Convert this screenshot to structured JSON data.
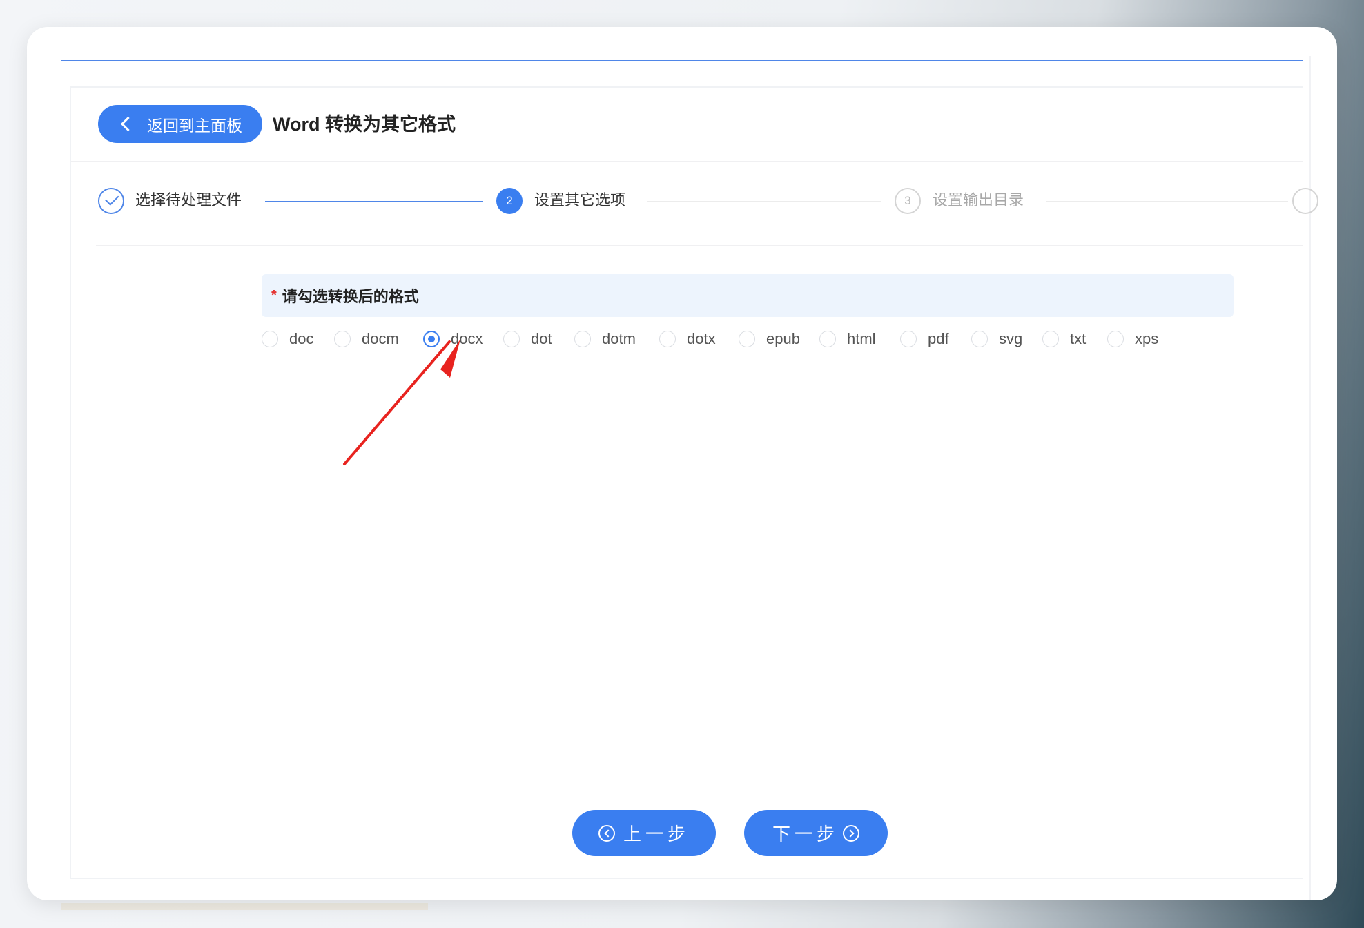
{
  "header": {
    "back_label": "返回到主面板",
    "title": "Word 转换为其它格式"
  },
  "steps": [
    {
      "index": "1",
      "label": "选择待处理文件",
      "status": "done"
    },
    {
      "index": "2",
      "label": "设置其它选项",
      "status": "active"
    },
    {
      "index": "3",
      "label": "设置输出目录",
      "status": "wait"
    }
  ],
  "form": {
    "required_mark": "*",
    "label": "请勾选转换后的格式",
    "options": [
      "doc",
      "docm",
      "docx",
      "dot",
      "dotm",
      "dotx",
      "epub",
      "html",
      "pdf",
      "svg",
      "txt",
      "xps"
    ],
    "selected": "docx"
  },
  "footer": {
    "prev_label": "上一步",
    "next_label": "下一步"
  },
  "colors": {
    "primary": "#3a7ef0",
    "annotation_arrow": "#e8231f"
  },
  "icons": {
    "back": "chevron-left-icon",
    "step_done": "check-icon",
    "prev": "circle-chevron-left-icon",
    "next": "circle-chevron-right-icon"
  }
}
